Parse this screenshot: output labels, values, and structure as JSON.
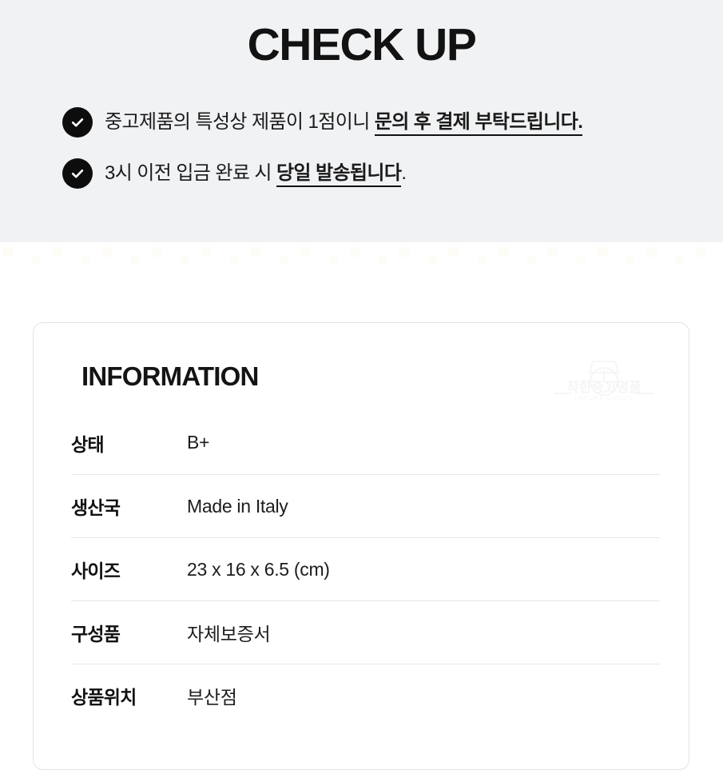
{
  "checkup": {
    "title": "CHECK UP",
    "items": [
      {
        "icon": "check-circle-icon",
        "lead": "중고제품의 특성상 제품이 1점이니 ",
        "emphasis": "문의 후 결제 부탁드립니다.",
        "trail": ""
      },
      {
        "icon": "check-circle-icon",
        "lead": "3시 이전 입금 완료 시 ",
        "emphasis": "당일 발송됩니다",
        "trail": "."
      }
    ]
  },
  "information": {
    "title": "INFORMATION",
    "watermark": {
      "brand": "착한중고명품",
      "tagline": "LUXURY GOODS",
      "icon": "watch-icon"
    },
    "rows": [
      {
        "label": "상태",
        "value": "B+"
      },
      {
        "label": "생산국",
        "value": "Made in Italy"
      },
      {
        "label": "사이즈",
        "value": "23 x 16 x 6.5 (cm)"
      },
      {
        "label": "구성품",
        "value": "자체보증서"
      },
      {
        "label": "상품위치",
        "value": "부산점"
      }
    ]
  },
  "colors": {
    "band_background": "#f1f2f4",
    "page_background": "#ffffff",
    "text_primary": "#121212",
    "check_circle": "#0d0d0d",
    "card_border": "#e3e4e6",
    "divider": "#e6e7e9",
    "watermark": "#f4f5f6"
  }
}
